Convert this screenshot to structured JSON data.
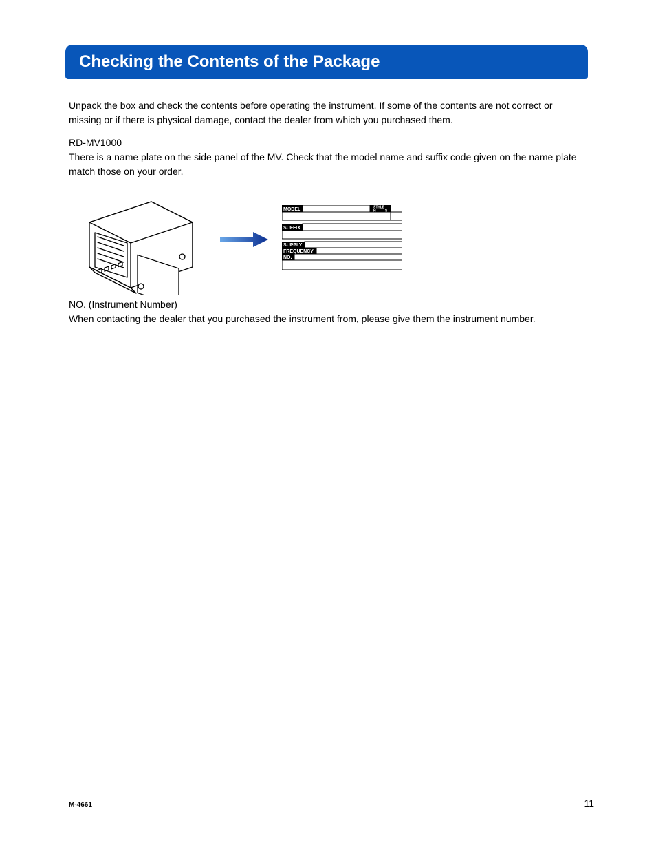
{
  "title": "Checking the Contents of the Package",
  "paragraphs": {
    "intro": "Unpack the box and check the contents before operating the instrument. If some of the contents are not correct or missing or if there is physical damage, contact the dealer from which you purchased them.",
    "model_heading": "RD-MV1000",
    "model_text": "There is a name plate on the side panel of the MV. Check that the model name and suffix code given on the name plate match those on your order.",
    "no_heading": "NO. (Instrument Number)",
    "no_text": "When contacting the dealer that you purchased the instrument from, please give them the instrument number."
  },
  "nameplate": {
    "model_label": "MODEL",
    "suffix_label": "SUFFIX",
    "supply_label": "SUPPLY",
    "frequency_label": "FREQUENCY",
    "no_label": "NO.",
    "style_label": "STYLE",
    "style_h": "H",
    "style_s": "S"
  },
  "footer": {
    "doc_number": "M-4661",
    "page_number": "11"
  }
}
